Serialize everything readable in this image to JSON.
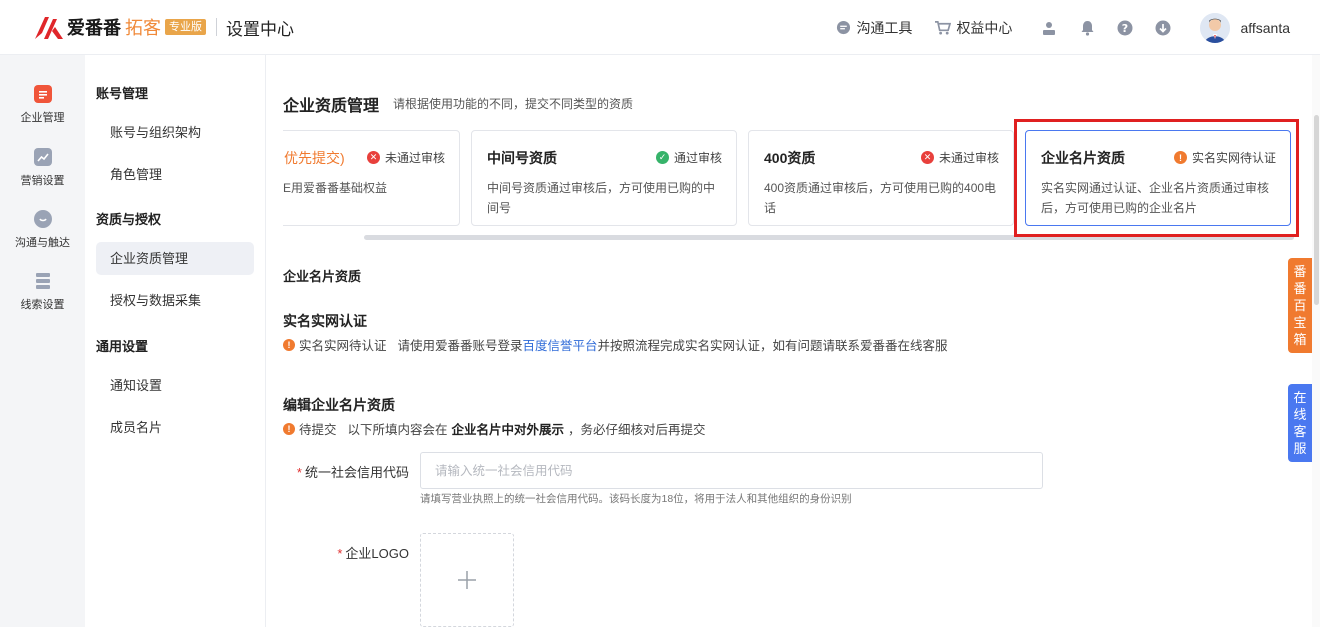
{
  "header": {
    "brand": "爱番番",
    "product": "拓客",
    "edition_badge": "专业版",
    "page_title": "设置中心",
    "links": [
      {
        "label": "沟通工具",
        "icon": "chat-icon"
      },
      {
        "label": "权益中心",
        "icon": "cart-icon"
      }
    ],
    "icons": [
      "download-tray-icon",
      "bell-icon",
      "help-icon",
      "download-icon"
    ],
    "username": "affsanta"
  },
  "rail": {
    "items": [
      {
        "label": "企业管理",
        "icon": "enterprise-icon",
        "color": "#f0553a"
      },
      {
        "label": "营销设置",
        "icon": "marketing-icon",
        "color": "#9aa3b5"
      },
      {
        "label": "沟通与触达",
        "icon": "communication-icon",
        "color": "#9aa3b5"
      },
      {
        "label": "线索设置",
        "icon": "leads-icon",
        "color": "#9aa3b5"
      }
    ]
  },
  "menu": {
    "groups": [
      "账号管理",
      "资质与授权",
      "通用设置"
    ],
    "items": [
      "账号与组织架构",
      "角色管理",
      "企业资质管理",
      "授权与数据采集",
      "通知设置",
      "成员名片"
    ]
  },
  "main": {
    "title": "企业资质管理",
    "description": "请根据使用功能的不同，提交不同类型的资质",
    "cards": [
      {
        "title": "优先提交)",
        "status": "未通过审核",
        "desc": "E用爱番番基础权益",
        "status_color": "#e8403c"
      },
      {
        "title": "中间号资质",
        "status": "通过审核",
        "desc": "中间号资质通过审核后，方可使用已购的中间号",
        "status_color": "#36b36a"
      },
      {
        "title": "400资质",
        "status": "未通过审核",
        "desc": "400资质通过审核后，方可使用已购的400电话",
        "status_color": "#e8403c"
      },
      {
        "title": "企业名片资质",
        "status": "实名实网待认证",
        "desc": "实名实网通过认证、企业名片资质通过审核后，方可使用已购的企业名片",
        "status_color": "#f07a2f"
      }
    ],
    "section_head": "企业名片资质",
    "realname": {
      "title": "实名实网认证",
      "status": "实名实网待认证",
      "text_before": "请使用爱番番账号登录",
      "link": "百度信誉平台",
      "text_after": "并按照流程完成实名实网认证，如有问题请联系爱番番在线客服"
    },
    "edit": {
      "title": "编辑企业名片资质",
      "status": "待提交",
      "text_before": "以下所填内容会在",
      "text_bold": "企业名片中对外展示",
      "text_after": "，务必仔细核对后再提交"
    },
    "form": {
      "credit_code_label": "统一社会信用代码",
      "credit_code_placeholder": "请输入统一社会信用代码",
      "credit_code_value": "",
      "credit_code_hint": "请填写营业执照上的统一社会信用代码。该码长度为18位，将用于法人和其他组织的身份识别",
      "logo_label": "企业LOGO",
      "required_mark": "*"
    }
  },
  "float_tabs": [
    {
      "label": "番番百宝箱",
      "color": "#f07a2f"
    },
    {
      "label": "在线客服",
      "color": "#4a78f0"
    }
  ]
}
